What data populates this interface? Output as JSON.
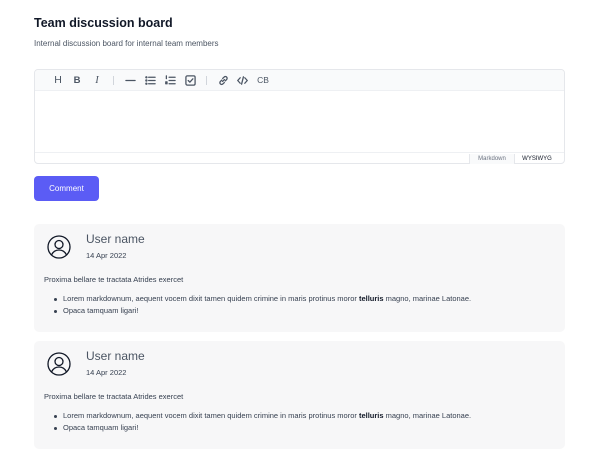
{
  "page": {
    "title": "Team discussion board",
    "subtitle": "Internal discussion board for internal team members"
  },
  "editor": {
    "toolbar": {
      "heading_glyph": "H",
      "bold_glyph": "B",
      "italic_glyph": "I",
      "codeblock_glyph": "CB"
    },
    "modes": {
      "markdown": "Markdown",
      "wysiwyg": "WYSIWYG",
      "active": "WYSIWYG"
    }
  },
  "comment_button": {
    "label": "Comment",
    "color": "#5b5cf5"
  },
  "comments": [
    {
      "user": "User name",
      "date": "14 Apr 2022",
      "intro": "Proxima bellare te tractata Atrides exercet",
      "list": [
        {
          "before": "Lorem markdownum, aequent vocem dixit tamen quidem crimine in maris protinus moror ",
          "bold": "telluris",
          "after": " magno, marinae Latonae."
        },
        {
          "text": "Opaca tamquam ligari!"
        }
      ]
    },
    {
      "user": "User name",
      "date": "14 Apr 2022",
      "intro": "Proxima bellare te tractata Atrides exercet",
      "list": [
        {
          "before": "Lorem markdownum, aequent vocem dixit tamen quidem crimine in maris protinus moror ",
          "bold": "telluris",
          "after": " magno, marinae Latonae."
        },
        {
          "text": "Opaca tamquam ligari!"
        }
      ]
    }
  ],
  "icons": [
    "heading-icon",
    "bold-icon",
    "italic-icon",
    "horizontal-rule-icon",
    "bullet-list-icon",
    "numbered-list-icon",
    "checklist-icon",
    "link-icon",
    "code-icon",
    "code-block-icon",
    "user-avatar-icon"
  ]
}
